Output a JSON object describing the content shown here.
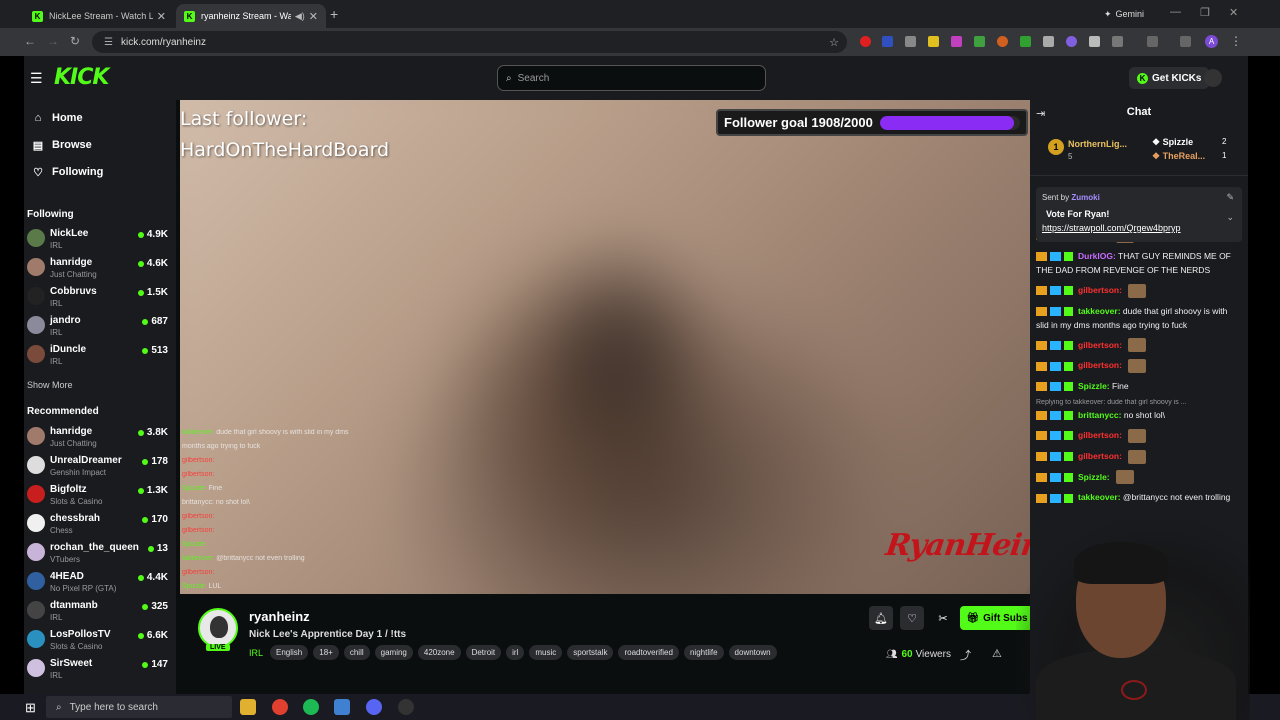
{
  "browser": {
    "tabs": [
      {
        "title": "NickLee Stream - Watch Live on"
      },
      {
        "title": "ryanheinz Stream - Watch L"
      }
    ],
    "gemini_label": "Gemini",
    "url": "kick.com/ryanheinz",
    "profile_initial": "A"
  },
  "header": {
    "logo": "KICK",
    "search_placeholder": "Search",
    "get_kicks": "Get KICKs"
  },
  "sidebar": {
    "nav": [
      {
        "label": "Home",
        "icon": "home-icon"
      },
      {
        "label": "Browse",
        "icon": "browse-icon"
      },
      {
        "label": "Following",
        "icon": "heart-icon"
      }
    ],
    "following_title": "Following",
    "following": [
      {
        "name": "NickLee",
        "category": "IRL",
        "viewers": "4.9K",
        "color": "#5a7a4a"
      },
      {
        "name": "hanridge",
        "category": "Just Chatting",
        "viewers": "4.6K",
        "color": "#a07a6a"
      },
      {
        "name": "Cobbruvs",
        "category": "IRL",
        "viewers": "1.5K",
        "color": "#222222"
      },
      {
        "name": "jandro",
        "category": "IRL",
        "viewers": "687",
        "color": "#8a8a9a"
      },
      {
        "name": "iDuncle",
        "category": "IRL",
        "viewers": "513",
        "color": "#7a4a3a"
      }
    ],
    "show_more": "Show More",
    "recommended_title": "Recommended",
    "recommended": [
      {
        "name": "hanridge",
        "category": "Just Chatting",
        "viewers": "3.8K",
        "color": "#a07a6a"
      },
      {
        "name": "UnrealDreamer",
        "category": "Genshin Impact",
        "viewers": "178",
        "color": "#dddddd"
      },
      {
        "name": "Bigfoltz",
        "category": "Slots & Casino",
        "viewers": "1.3K",
        "color": "#c81e1e"
      },
      {
        "name": "chessbrah",
        "category": "Chess",
        "viewers": "170",
        "color": "#f0f0f0"
      },
      {
        "name": "rochan_the_queen",
        "category": "VTubers",
        "viewers": "13",
        "color": "#c8b4d8"
      },
      {
        "name": "4HEAD",
        "category": "No Pixel RP (GTA)",
        "viewers": "4.4K",
        "color": "#3060a0"
      },
      {
        "name": "dtanmanb",
        "category": "IRL",
        "viewers": "325",
        "color": "#444444"
      },
      {
        "name": "LosPollosTV",
        "category": "Slots & Casino",
        "viewers": "6.6K",
        "color": "#2a90c0"
      },
      {
        "name": "SirSweet",
        "category": "IRL",
        "viewers": "147",
        "color": "#d0c0e0"
      }
    ]
  },
  "video": {
    "last_follower_label": "Last follower:",
    "last_follower_name": "HardOnTheHardBoard",
    "goal_text": "Follower goal 1908/2000",
    "goal_fraction": 0.954,
    "watermark": "RyanHeinz",
    "overlay_chat": [
      {
        "user": "takkeover:",
        "text": "dude that girl shoovy is with slid in my dms",
        "color": "green"
      },
      {
        "user": "",
        "text": "months ago trying to fuck",
        "color": "none"
      },
      {
        "user": "gilbertson:",
        "text": "",
        "color": "red"
      },
      {
        "user": "gilbertson:",
        "text": "",
        "color": "red"
      },
      {
        "user": "Spizzle:",
        "text": "Fine",
        "color": "green"
      },
      {
        "user": "brittanycc:",
        "text": "no shot lol\\",
        "color": "none"
      },
      {
        "user": "gilbertson:",
        "text": "",
        "color": "red"
      },
      {
        "user": "gilbertson:",
        "text": "",
        "color": "red"
      },
      {
        "user": "Spizzle:",
        "text": "",
        "color": "green"
      },
      {
        "user": "takkeover:",
        "text": "@brittanycc not even trolling",
        "color": "green"
      },
      {
        "user": "gilbertson:",
        "text": "",
        "color": "red"
      },
      {
        "user": "Spizzle:",
        "text": "LUL",
        "color": "green"
      }
    ]
  },
  "stream": {
    "streamer": "ryanheinz",
    "live": "LIVE",
    "title": "Nick Lee's Apprentice Day 1 / !tts",
    "category": "IRL",
    "tags": [
      "English",
      "18+",
      "chill",
      "gaming",
      "420zone",
      "Detroit",
      "irl",
      "music",
      "sportstalk",
      "roadtoverified",
      "nightlife",
      "downtown"
    ],
    "gift_subs": "Gift Subs",
    "viewers": "60",
    "viewers_label": "Viewers"
  },
  "chat": {
    "title": "Chat",
    "leaderboard": [
      {
        "name": "NorthernLig...",
        "sub": "5",
        "color": "#e8c060"
      },
      {
        "name": "Spizzle",
        "count": "2",
        "color": "#ffffff"
      },
      {
        "name": "TheReal...",
        "count": "1",
        "color": "#e8a060"
      }
    ],
    "pinned": {
      "sent_by_label": "Sent by",
      "sent_by": "Zumoki",
      "message": "Vote For Ryan!",
      "link": "https://strawpoll.com/Qrgew4bpryp"
    },
    "messages": [
      {
        "user": "Spizzle:",
        "text": "",
        "color": "#53fc18",
        "emote": true
      },
      {
        "user": "DurkIOG:",
        "text": "THAT GUY REMINDS ME OF THE DAD FROM REVENGE OF THE NERDS",
        "color": "#c86bff",
        "emote": false
      },
      {
        "user": "gilbertson:",
        "text": "",
        "color": "#ff3030",
        "emote": true
      },
      {
        "user": "takkeover:",
        "text": "dude that girl shoovy is with slid in my dms months ago trying to fuck",
        "color": "#53fc18",
        "emote": false
      },
      {
        "user": "gilbertson:",
        "text": "",
        "color": "#ff3030",
        "emote": true
      },
      {
        "user": "gilbertson:",
        "text": "",
        "color": "#ff3030",
        "emote": true
      },
      {
        "user": "Spizzle:",
        "text": "Fine",
        "color": "#53fc18",
        "emote": false
      },
      {
        "reply": "Replying to takkeover: dude that girl shoovy is ..."
      },
      {
        "user": "brittanycc:",
        "text": "no shot lol\\",
        "color": "#53fc18",
        "emote": false
      },
      {
        "user": "gilbertson:",
        "text": "",
        "color": "#ff3030",
        "emote": true
      },
      {
        "user": "gilbertson:",
        "text": "",
        "color": "#ff3030",
        "emote": true
      },
      {
        "user": "Spizzle:",
        "text": "",
        "color": "#53fc18",
        "emote": true
      },
      {
        "user": "takkeover:",
        "text": "@brittanycc not even trolling",
        "color": "#53fc18",
        "emote": false
      }
    ]
  },
  "taskbar": {
    "search_placeholder": "Type here to search"
  }
}
